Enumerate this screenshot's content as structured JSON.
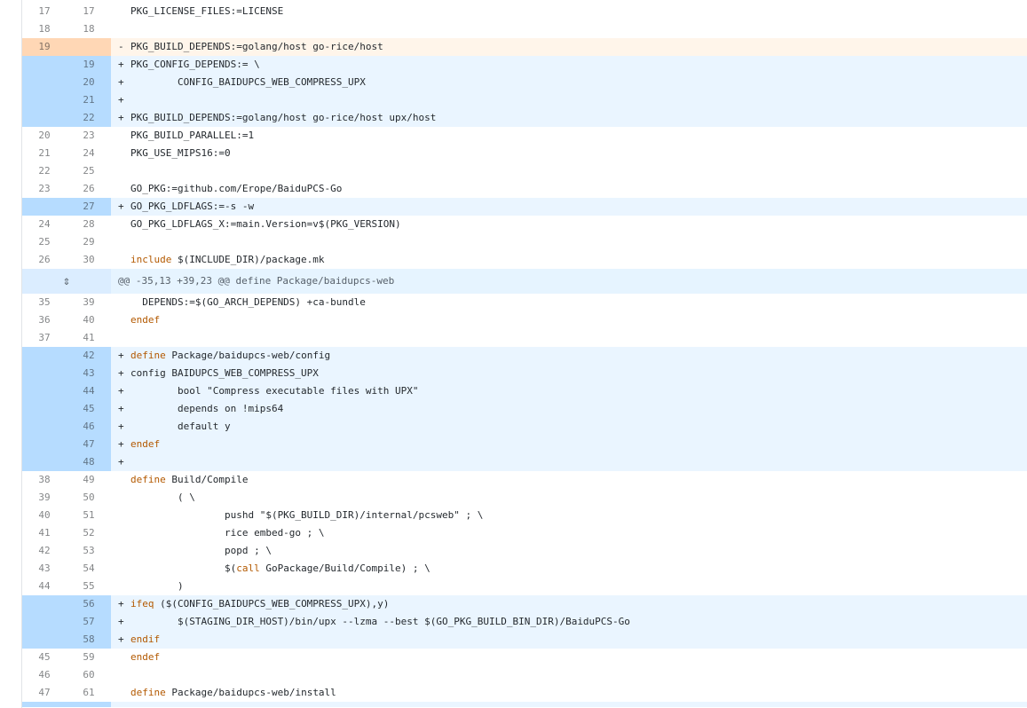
{
  "rows": [
    {
      "type": "ctx",
      "old": "17",
      "new": "17",
      "marker": " ",
      "code": [
        {
          "t": "PKG_LICENSE_FILES:=LICENSE"
        }
      ]
    },
    {
      "type": "ctx",
      "old": "18",
      "new": "18",
      "marker": " ",
      "code": [
        {
          "t": ""
        }
      ]
    },
    {
      "type": "del",
      "old": "19",
      "new": "",
      "marker": "-",
      "code": [
        {
          "t": "PKG_BUILD_DEPENDS:=golang/host go-rice/host"
        }
      ]
    },
    {
      "type": "add",
      "old": "",
      "new": "19",
      "marker": "+",
      "code": [
        {
          "t": "PKG_CONFIG_DEPENDS:= \\"
        }
      ]
    },
    {
      "type": "add",
      "old": "",
      "new": "20",
      "marker": "+",
      "code": [
        {
          "t": "        CONFIG_BAIDUPCS_WEB_COMPRESS_UPX"
        }
      ]
    },
    {
      "type": "add",
      "old": "",
      "new": "21",
      "marker": "+",
      "code": [
        {
          "t": ""
        }
      ]
    },
    {
      "type": "add",
      "old": "",
      "new": "22",
      "marker": "+",
      "code": [
        {
          "t": "PKG_BUILD_DEPENDS:=golang/host go-rice/host upx/host"
        }
      ]
    },
    {
      "type": "ctx",
      "old": "20",
      "new": "23",
      "marker": " ",
      "code": [
        {
          "t": "PKG_BUILD_PARALLEL:=1"
        }
      ]
    },
    {
      "type": "ctx",
      "old": "21",
      "new": "24",
      "marker": " ",
      "code": [
        {
          "t": "PKG_USE_MIPS16:=0"
        }
      ]
    },
    {
      "type": "ctx",
      "old": "22",
      "new": "25",
      "marker": " ",
      "code": [
        {
          "t": ""
        }
      ]
    },
    {
      "type": "ctx",
      "old": "23",
      "new": "26",
      "marker": " ",
      "code": [
        {
          "t": "GO_PKG:=github.com/Erope/BaiduPCS-Go"
        }
      ]
    },
    {
      "type": "add",
      "old": "",
      "new": "27",
      "marker": "+",
      "code": [
        {
          "t": "GO_PKG_LDFLAGS:=-s -w"
        }
      ]
    },
    {
      "type": "ctx",
      "old": "24",
      "new": "28",
      "marker": " ",
      "code": [
        {
          "t": "GO_PKG_LDFLAGS_X:=main.Version=v$(PKG_VERSION)"
        }
      ]
    },
    {
      "type": "ctx",
      "old": "25",
      "new": "29",
      "marker": " ",
      "code": [
        {
          "t": ""
        }
      ]
    },
    {
      "type": "ctx",
      "old": "26",
      "new": "30",
      "marker": " ",
      "code": [
        {
          "t": "include",
          "kw": true
        },
        {
          "t": " $(INCLUDE_DIR)/package.mk"
        }
      ]
    },
    {
      "type": "hunk",
      "code": [
        {
          "t": "@@ -35,13 +39,23 @@ define Package/baidupcs-web"
        }
      ]
    },
    {
      "type": "ctx",
      "old": "35",
      "new": "39",
      "marker": " ",
      "code": [
        {
          "t": "  DEPENDS:=$(GO_ARCH_DEPENDS) +ca-bundle"
        }
      ]
    },
    {
      "type": "ctx",
      "old": "36",
      "new": "40",
      "marker": " ",
      "code": [
        {
          "t": "endef",
          "kw": true
        }
      ]
    },
    {
      "type": "ctx",
      "old": "37",
      "new": "41",
      "marker": " ",
      "code": [
        {
          "t": ""
        }
      ]
    },
    {
      "type": "add",
      "old": "",
      "new": "42",
      "marker": "+",
      "code": [
        {
          "t": "define",
          "kw": true
        },
        {
          "t": " Package/baidupcs-web/config"
        }
      ]
    },
    {
      "type": "add",
      "old": "",
      "new": "43",
      "marker": "+",
      "code": [
        {
          "t": "config BAIDUPCS_WEB_COMPRESS_UPX"
        }
      ]
    },
    {
      "type": "add",
      "old": "",
      "new": "44",
      "marker": "+",
      "code": [
        {
          "t": "        bool \"Compress executable files with UPX\""
        }
      ]
    },
    {
      "type": "add",
      "old": "",
      "new": "45",
      "marker": "+",
      "code": [
        {
          "t": "        depends on !mips64"
        }
      ]
    },
    {
      "type": "add",
      "old": "",
      "new": "46",
      "marker": "+",
      "code": [
        {
          "t": "        default y"
        }
      ]
    },
    {
      "type": "add",
      "old": "",
      "new": "47",
      "marker": "+",
      "code": [
        {
          "t": "endef",
          "kw": true
        }
      ]
    },
    {
      "type": "add",
      "old": "",
      "new": "48",
      "marker": "+",
      "code": [
        {
          "t": ""
        }
      ]
    },
    {
      "type": "ctx",
      "old": "38",
      "new": "49",
      "marker": " ",
      "code": [
        {
          "t": "define",
          "kw": true
        },
        {
          "t": " Build/Compile"
        }
      ]
    },
    {
      "type": "ctx",
      "old": "39",
      "new": "50",
      "marker": " ",
      "code": [
        {
          "t": "        ( \\"
        }
      ]
    },
    {
      "type": "ctx",
      "old": "40",
      "new": "51",
      "marker": " ",
      "code": [
        {
          "t": "                pushd \"$(PKG_BUILD_DIR)/internal/pcsweb\" ; \\"
        }
      ]
    },
    {
      "type": "ctx",
      "old": "41",
      "new": "52",
      "marker": " ",
      "code": [
        {
          "t": "                rice embed-go ; \\"
        }
      ]
    },
    {
      "type": "ctx",
      "old": "42",
      "new": "53",
      "marker": " ",
      "code": [
        {
          "t": "                popd ; \\"
        }
      ]
    },
    {
      "type": "ctx",
      "old": "43",
      "new": "54",
      "marker": " ",
      "code": [
        {
          "t": "                $("
        },
        {
          "t": "call",
          "kw": true
        },
        {
          "t": " GoPackage/Build/Compile) ; \\"
        }
      ]
    },
    {
      "type": "ctx",
      "old": "44",
      "new": "55",
      "marker": " ",
      "code": [
        {
          "t": "        )"
        }
      ]
    },
    {
      "type": "add",
      "old": "",
      "new": "56",
      "marker": "+",
      "code": [
        {
          "t": "ifeq",
          "kw": true
        },
        {
          "t": " ($(CONFIG_BAIDUPCS_WEB_COMPRESS_UPX),y)"
        }
      ]
    },
    {
      "type": "add",
      "old": "",
      "new": "57",
      "marker": "+",
      "code": [
        {
          "t": "        $(STAGING_DIR_HOST)/bin/upx --lzma --best $(GO_PKG_BUILD_BIN_DIR)/BaiduPCS-Go"
        }
      ]
    },
    {
      "type": "add",
      "old": "",
      "new": "58",
      "marker": "+",
      "code": [
        {
          "t": "endif",
          "kw": true
        }
      ]
    },
    {
      "type": "ctx",
      "old": "45",
      "new": "59",
      "marker": " ",
      "code": [
        {
          "t": "endef",
          "kw": true
        }
      ]
    },
    {
      "type": "ctx",
      "old": "46",
      "new": "60",
      "marker": " ",
      "code": [
        {
          "t": ""
        }
      ]
    },
    {
      "type": "ctx",
      "old": "47",
      "new": "61",
      "marker": " ",
      "code": [
        {
          "t": "define",
          "kw": true
        },
        {
          "t": " Package/baidupcs-web/install"
        }
      ]
    }
  ],
  "hunk_expand_icon": "expand-vertical-icon",
  "colors": {
    "add_gutter": "#b6dcff",
    "add_code": "#eaf5ff",
    "del_gutter": "#ffd7b5",
    "del_code": "#fff5ea",
    "hunk_bg": "#e6f4ff",
    "keyword": "#b35900"
  }
}
